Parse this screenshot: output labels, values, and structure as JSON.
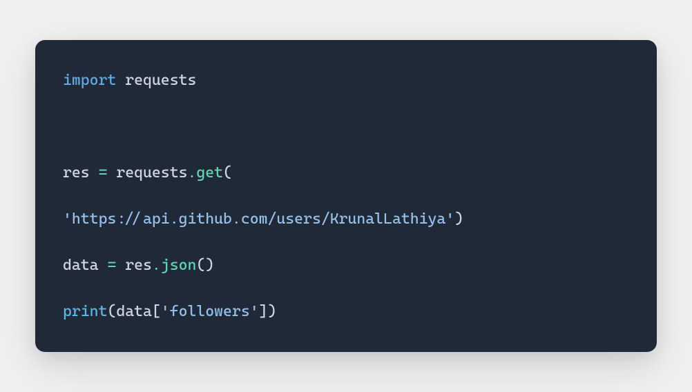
{
  "code": {
    "line1_kw": "import",
    "line1_sep": " ",
    "line1_mod": "requests",
    "line2_var": "res",
    "line2_sep1": " ",
    "line2_eq": "=",
    "line2_sep2": " ",
    "line2_obj": "requests",
    "line2_dot": ".",
    "line2_func": "get",
    "line2_open": "(",
    "line3_str": "'https://api.github.com/users/KrunalLathiya'",
    "line3_close": ")",
    "line4_var": "data",
    "line4_sep1": " ",
    "line4_eq": "=",
    "line4_sep2": " ",
    "line4_obj": "res",
    "line4_dot": ".",
    "line4_func": "json",
    "line4_open": "(",
    "line4_close": ")",
    "line5_func": "print",
    "line5_open": "(",
    "line5_arg": "data",
    "line5_bopen": "[",
    "line5_str": "'followers'",
    "line5_bclose": "]",
    "line5_close": ")"
  }
}
